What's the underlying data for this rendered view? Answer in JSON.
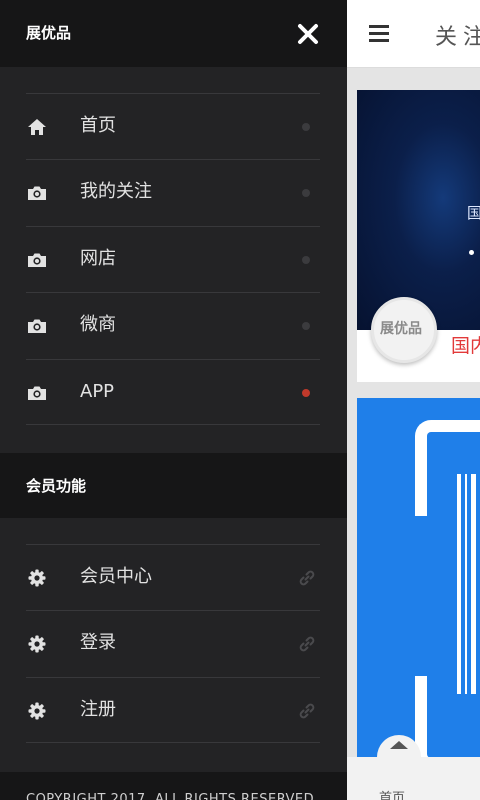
{
  "drawer": {
    "title": "展优品",
    "close_icon": "close-icon",
    "items": [
      {
        "label": "首页",
        "icon": "home-icon",
        "state": "inactive"
      },
      {
        "label": "我的关注",
        "icon": "camera-icon",
        "state": "inactive"
      },
      {
        "label": "网店",
        "icon": "camera-icon",
        "state": "inactive"
      },
      {
        "label": "微商",
        "icon": "camera-icon",
        "state": "inactive"
      },
      {
        "label": "APP",
        "icon": "camera-icon",
        "state": "active"
      }
    ],
    "member_section": {
      "title": "会员功能",
      "items": [
        {
          "label": "会员中心",
          "icon": "gear-icon",
          "trailing_icon": "link-icon"
        },
        {
          "label": "登录",
          "icon": "gear-icon",
          "trailing_icon": "link-icon"
        },
        {
          "label": "注册",
          "icon": "gear-icon",
          "trailing_icon": "link-icon"
        }
      ]
    },
    "copyright": "COPYRIGHT 2017. ALL RIGHTS RESERVED"
  },
  "main": {
    "page_title": "关注",
    "menu_icon": "hamburger-icon",
    "card1": {
      "banner_text": "国",
      "brand_label": "展优品",
      "red_text": "国内"
    },
    "bottom_nav": {
      "label": "首页"
    }
  },
  "colors": {
    "drawer_bg": "#232325",
    "drawer_header_bg": "#161617",
    "active_dot": "#c0392b",
    "card2_blue": "#1f7fe9"
  }
}
